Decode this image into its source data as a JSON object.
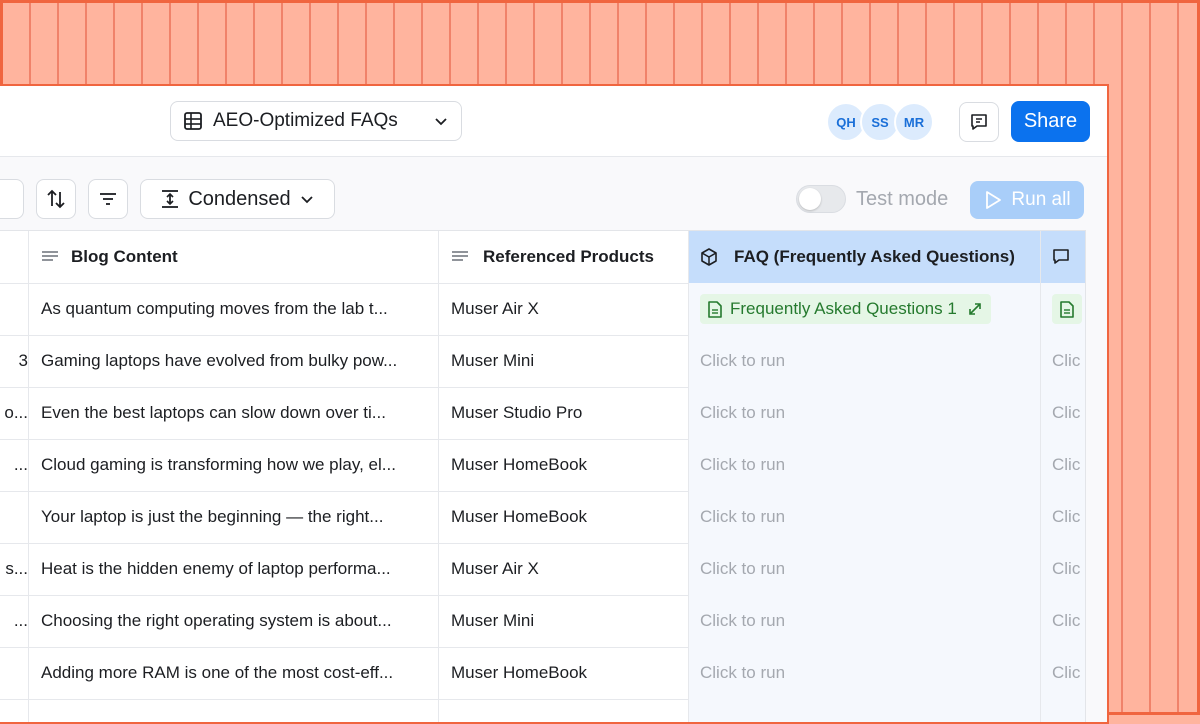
{
  "topbar": {
    "view_name": "AEO-Optimized FAQs",
    "avatars": [
      "QH",
      "SS",
      "MR"
    ],
    "share_label": "Share"
  },
  "toolbar": {
    "density_label": "Condensed",
    "test_mode_label": "Test mode",
    "test_mode_on": false,
    "run_all_label": "Run all"
  },
  "table": {
    "columns": [
      "",
      "Blog Content",
      "Referenced Products",
      "FAQ (Frequently Asked Questions)",
      ""
    ],
    "rows": [
      {
        "prefix": "",
        "blog": "As quantum computing moves from the lab t...",
        "product": "Muser Air X",
        "faq": "Frequently Asked Questions 1",
        "next": ""
      },
      {
        "prefix": "3",
        "blog": "Gaming laptops have evolved from bulky pow...",
        "product": "Muser Mini",
        "faq": "Click to run",
        "next": "Clic"
      },
      {
        "prefix": "o...",
        "blog": "Even the best laptops can slow down over ti...",
        "product": "Muser Studio Pro",
        "faq": "Click to run",
        "next": "Clic"
      },
      {
        "prefix": "...",
        "blog": "Cloud gaming is transforming how we play, el...",
        "product": "Muser HomeBook",
        "faq": "Click to run",
        "next": "Clic"
      },
      {
        "prefix": "",
        "blog": "Your laptop is just the beginning — the right...",
        "product": "Muser HomeBook",
        "faq": "Click to run",
        "next": "Clic"
      },
      {
        "prefix": "s...",
        "blog": "Heat is the hidden enemy of laptop performa...",
        "product": "Muser Air X",
        "faq": "Click to run",
        "next": "Clic"
      },
      {
        "prefix": "...",
        "blog": "Choosing the right operating system is about...",
        "product": "Muser Mini",
        "faq": "Click to run",
        "next": "Clic"
      },
      {
        "prefix": "",
        "blog": "Adding more RAM is one of the most cost-eff...",
        "product": "Muser HomeBook",
        "faq": "Click to run",
        "next": "Clic"
      }
    ]
  },
  "colors": {
    "accent": "#0B72EE",
    "faq_header": "#C5DDFB",
    "badge_bg": "#E5F6E6",
    "badge_text": "#257A2E",
    "border_frame": "#F0653F"
  }
}
